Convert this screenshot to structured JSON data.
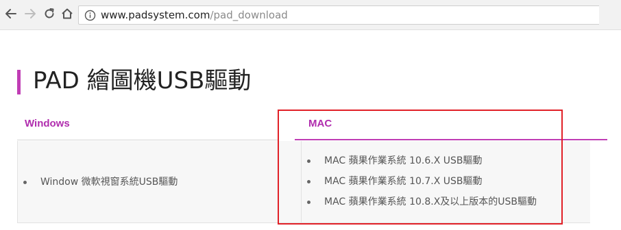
{
  "browser": {
    "url_host": "www.padsystem.com",
    "url_path": "/pad_download"
  },
  "page": {
    "title": "PAD 繪圖機USB驅動"
  },
  "tabs": [
    {
      "label": "Windows"
    },
    {
      "label": "MAC"
    }
  ],
  "windows": {
    "items": [
      "Window 微軟視窗系統USB驅動"
    ]
  },
  "mac": {
    "items": [
      "MAC 蘋果作業系統 10.6.X USB驅動",
      "MAC 蘋果作業系統 10.7.X USB驅動",
      "MAC 蘋果作業系統 10.8.X及以上版本的USB驅動"
    ]
  },
  "colors": {
    "accent": "#b02dae",
    "highlight": "#e11f26"
  }
}
